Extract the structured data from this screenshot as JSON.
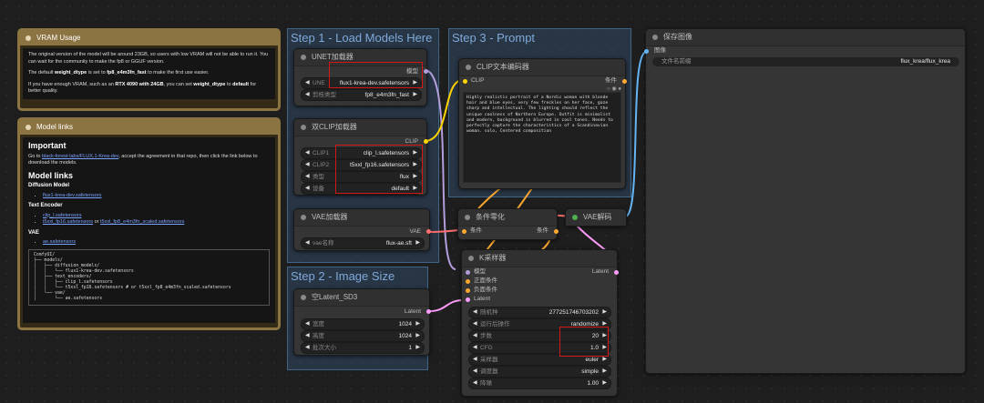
{
  "groups": {
    "step1": "Step 1 - Load Models Here",
    "step2": "Step 2 - Image Size",
    "step3": "Step 3 - Prompt"
  },
  "vram_note": {
    "title": "VRAM Usage",
    "p1": "The original version of the model will be around 23GB, so users with low VRAM will not be able to run it. You can wait for the community to make the fp8 or GGUF version.",
    "p2_pre": "The default ",
    "p2_b1": "weight_dtype",
    "p2_mid": " is set to ",
    "p2_b2": "fp8_e4m3fn_fast",
    "p2_post": " to make the first use easier.",
    "p3_pre": "If you have enough VRAM, such as an ",
    "p3_b1": "RTX 4090 with 24GB",
    "p3_mid": ", you can set ",
    "p3_b2": "weight_dtype",
    "p3_mid2": " to ",
    "p3_b3": "default",
    "p3_post": " for better quality."
  },
  "links_note": {
    "title": "Model links",
    "important_heading": "Important",
    "go_to": "Go to ",
    "repo_link": "black-forest-labs/FLUX.1-Krea-dev",
    "go_to_post": ", accept the agreement in that repo, then click the link below to download the models.",
    "model_links_heading": "Model links",
    "diffusion_heading": "Diffusion Model",
    "diffusion_file": "flux1-krea-dev.safetensors",
    "text_encoder_heading": "Text Encoder",
    "te_file1": "clip_l.safetensors",
    "te_file2": "t5xxl_fp16.safetensors",
    "te_or": " or ",
    "te_file3": "t5xxl_fp8_e4m3fn_scaled.safetensors",
    "vae_heading": "VAE",
    "vae_file": "ae.safetensors",
    "tree": "ComfyUI/\n├── models/\n│   ├── diffusion_models/\n│   │   └── flux1-krea-dev.safetensors\n│   ├── text_encoders/\n│   │   ├── clip_l.safetensors\n│   │   └── t5xxl_fp16.safetensors # or t5xxl_fp8_e4m3fn_scaled.safetensors\n│   └── vae/\n│       └── ae.safetensors"
  },
  "unet": {
    "title": "UNET加载器",
    "output": "模型",
    "unet_label": "UNE",
    "unet_value": "flux1-krea-dev.safetensors",
    "dtype_label": "剪枝类型",
    "dtype_value": "fp8_e4m3fn_fast"
  },
  "dualclip": {
    "title": "双CLIP加载器",
    "output": "CLIP",
    "clip1_label": "CLIP1",
    "clip1_value": "clip_l.safetensors",
    "clip2_label": "CLIP2",
    "clip2_value": "t5xxl_fp16.safetensors",
    "type_label": "类型",
    "type_value": "flux",
    "device_label": "设备",
    "device_value": "default"
  },
  "vaeloader": {
    "title": "VAE加载器",
    "output": "VAE",
    "name_label": "vae名称",
    "name_value": "flux-ae.sft"
  },
  "latent": {
    "title": "空Latent_SD3",
    "output": "Latent",
    "width_label": "宽度",
    "width_value": "1024",
    "height_label": "高度",
    "height_value": "1024",
    "batch_label": "批次大小",
    "batch_value": "1"
  },
  "clipencode": {
    "title": "CLIP文本编码器",
    "input": "CLIP",
    "output": "条件",
    "text": "Highly realistic portrait of a Nordic woman with blonde hair and blue eyes, very few freckles on her face, gaze sharp and intellectual. The lighting should reflect the unique coolness of Northern Europe. Outfit is minimalist and modern, background is blurred in cool tones. Needs to perfectly capture the characteristics of a Scandinavian woman. solo, Centered composition"
  },
  "condzero": {
    "title": "条件零化",
    "input": "条件",
    "output": "条件"
  },
  "vaedecode": {
    "title": "VAE解码"
  },
  "ksampler": {
    "title": "K采样器",
    "in_model": "模型",
    "in_pos": "正面条件",
    "in_neg": "负面条件",
    "in_latent": "Latent",
    "output": "Latent",
    "seed_label": "随机种",
    "seed_value": "277251746703202",
    "control_label": "运行后操作",
    "control_value": "randomize",
    "steps_label": "步数",
    "steps_value": "20",
    "cfg_label": "CFG",
    "cfg_value": "1.0",
    "sampler_label": "采样器",
    "sampler_value": "euler",
    "scheduler_label": "调度器",
    "scheduler_value": "simple",
    "denoise_label": "降噪",
    "denoise_value": "1.00"
  },
  "saveimage": {
    "title": "保存图像",
    "input": "图像",
    "prefix_label": "文件名前缀",
    "prefix_value": "flux_krea/flux_krea"
  },
  "colors": {
    "model": "#b39ddb",
    "clip": "#ffd500",
    "vae": "#ff6e6e",
    "latent": "#ff9cf9",
    "conditioning": "#ffa931",
    "image": "#64b5f6"
  }
}
